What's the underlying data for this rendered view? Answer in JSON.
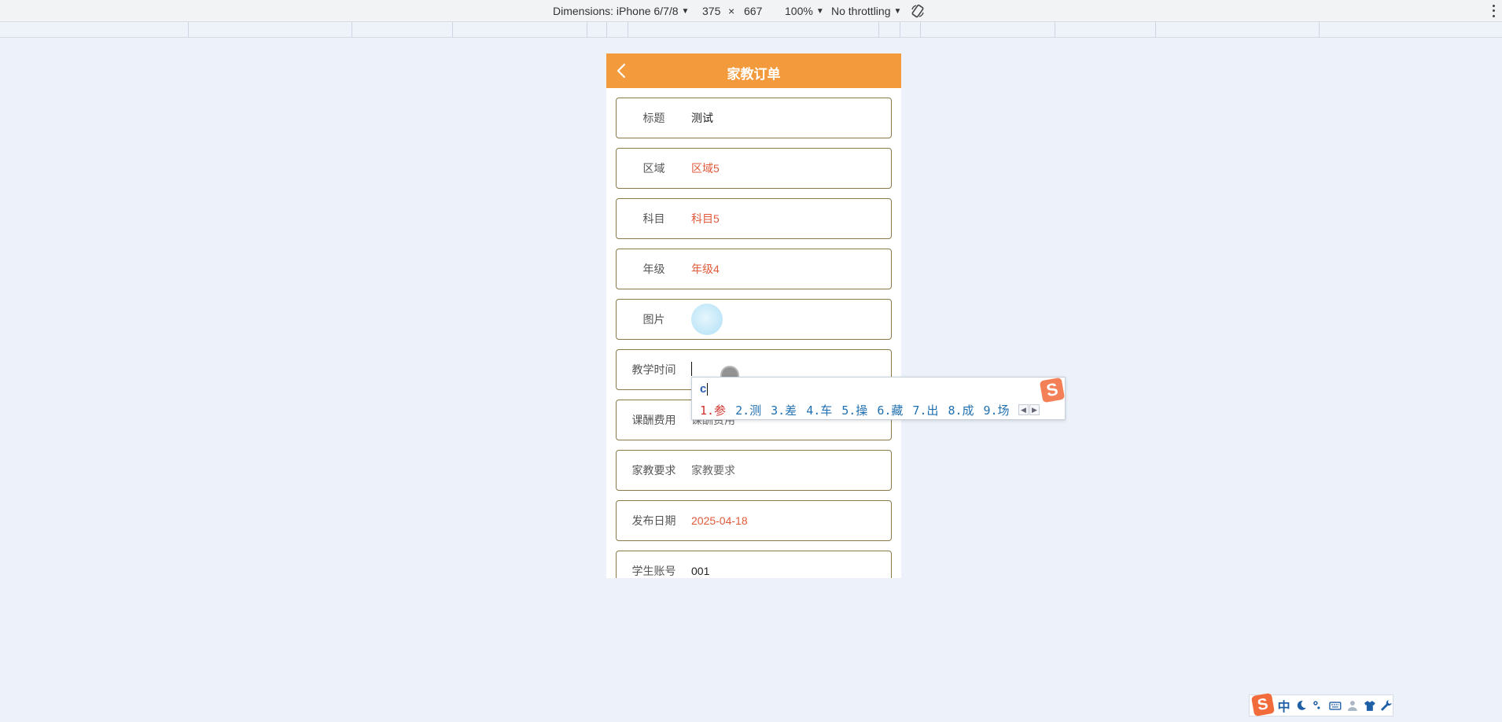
{
  "devtools": {
    "dimensions_label": "Dimensions: iPhone 6/7/8",
    "width": "375",
    "times": "×",
    "height": "667",
    "zoom": "100%",
    "throttling": "No throttling"
  },
  "app": {
    "title": "家教订单",
    "accent": "#f39a3c",
    "fields": [
      {
        "label": "标题",
        "value": "测试"
      },
      {
        "label": "区域",
        "value": "区域5"
      },
      {
        "label": "科目",
        "value": "科目5"
      },
      {
        "label": "年级",
        "value": "年级4"
      },
      {
        "label": "图片",
        "value": ""
      },
      {
        "label": "教学时间",
        "value": ""
      },
      {
        "label": "课酬费用",
        "value": "课酬费用"
      },
      {
        "label": "家教要求",
        "value": "家教要求"
      },
      {
        "label": "发布日期",
        "value": "2025-04-18"
      },
      {
        "label": "学生账号",
        "value": "001"
      }
    ]
  },
  "ime": {
    "composition": "c",
    "logo": "S",
    "candidates": [
      "1.参",
      "2.测",
      "3.差",
      "4.车",
      "5.操",
      "6.藏",
      "7.出",
      "8.成",
      "9.场"
    ]
  },
  "ime_status": {
    "logo": "S",
    "mode": "中"
  }
}
